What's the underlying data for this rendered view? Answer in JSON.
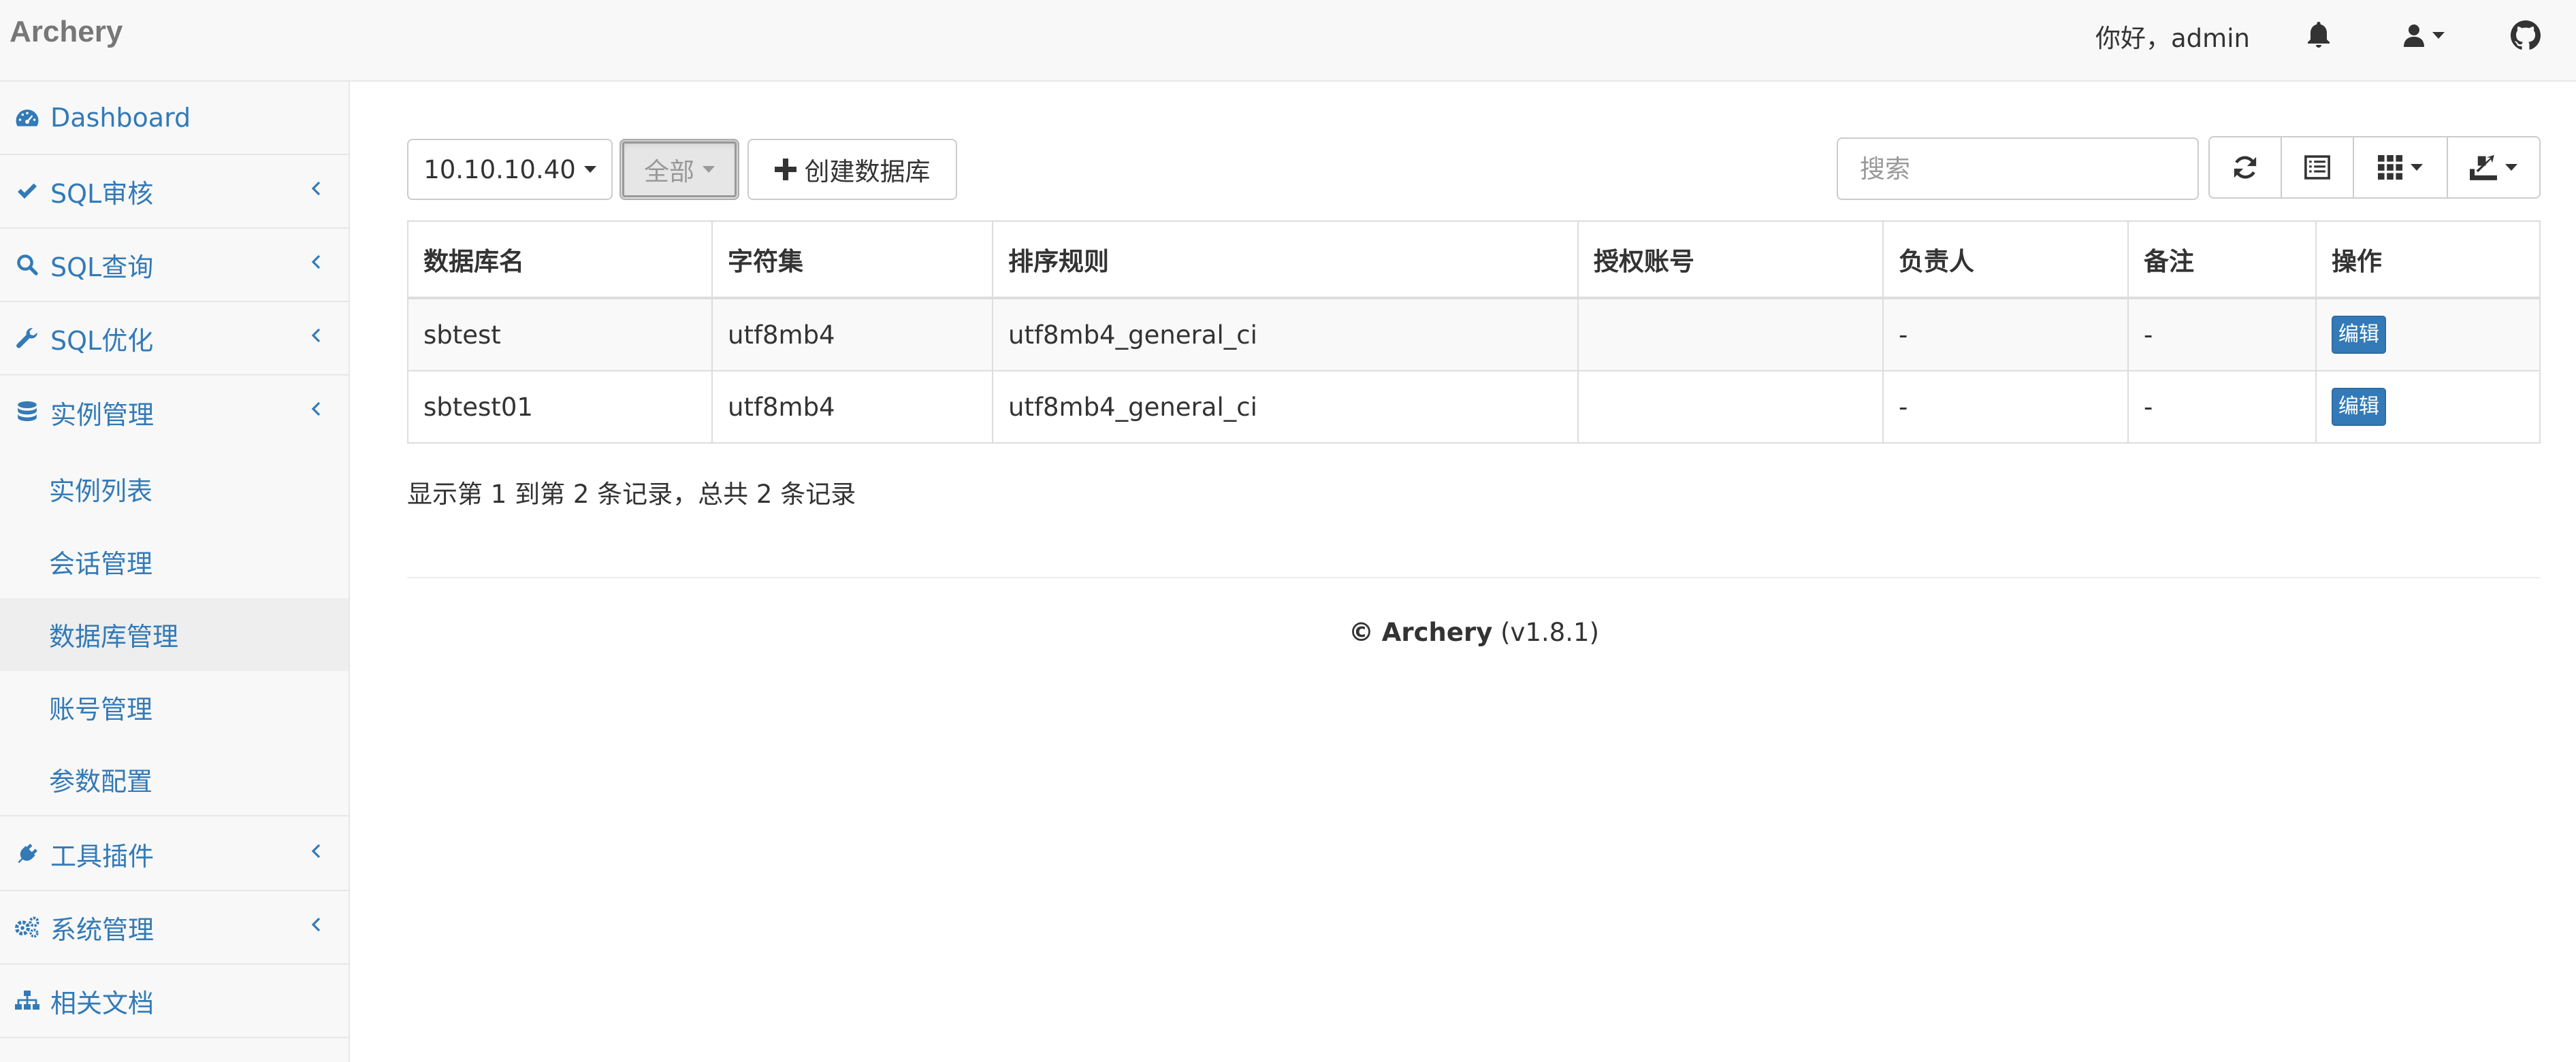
{
  "navbar": {
    "brand": "Archery",
    "greeting": "你好，admin",
    "icons": [
      "bell-icon",
      "user-icon",
      "github-icon"
    ]
  },
  "sidebar": {
    "items": [
      {
        "label": "Dashboard",
        "icon": "dashboard-icon",
        "expandable": false
      },
      {
        "label": "SQL审核",
        "icon": "check-icon",
        "expandable": true
      },
      {
        "label": "SQL查询",
        "icon": "search-icon",
        "expandable": true
      },
      {
        "label": "SQL优化",
        "icon": "wrench-icon",
        "expandable": true
      },
      {
        "label": "实例管理",
        "icon": "database-icon",
        "expandable": true
      }
    ],
    "sub_items": [
      {
        "label": "实例列表",
        "active": false
      },
      {
        "label": "会话管理",
        "active": false
      },
      {
        "label": "数据库管理",
        "active": true
      },
      {
        "label": "账号管理",
        "active": false
      },
      {
        "label": "参数配置",
        "active": false
      }
    ],
    "bottom_items": [
      {
        "label": "工具插件",
        "icon": "plug-icon",
        "expandable": true
      },
      {
        "label": "系统管理",
        "icon": "cogs-icon",
        "expandable": true
      },
      {
        "label": "相关文档",
        "icon": "sitemap-icon",
        "expandable": false
      }
    ]
  },
  "toolbar": {
    "instance_select": "10.10.10.40",
    "filter_select": "全部",
    "create_button": "创建数据库",
    "search_placeholder": "搜索"
  },
  "table": {
    "columns": [
      "数据库名",
      "字符集",
      "排序规则",
      "授权账号",
      "负责人",
      "备注",
      "操作"
    ],
    "rows": [
      {
        "db_name": "sbtest",
        "charset": "utf8mb4",
        "collation": "utf8mb4_general_ci",
        "grant_accounts": "",
        "owner": "-",
        "remark": "-",
        "action": "编辑"
      },
      {
        "db_name": "sbtest01",
        "charset": "utf8mb4",
        "collation": "utf8mb4_general_ci",
        "grant_accounts": "",
        "owner": "-",
        "remark": "-",
        "action": "编辑"
      }
    ]
  },
  "pagination": {
    "info": "显示第 1 到第 2 条记录，总共 2 条记录"
  },
  "footer": {
    "copyright": "©",
    "brand": "Archery",
    "version": "(v1.8.1)"
  },
  "colors": {
    "link": "#337ab7",
    "navbar_bg": "#f8f8f8",
    "primary_button": "#337ab7"
  }
}
